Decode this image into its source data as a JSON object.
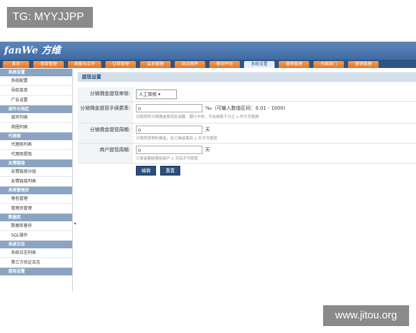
{
  "watermarks": {
    "top_left": "TG: MYYJJPP",
    "bottom_right": "www.jitou.org"
  },
  "header": {
    "logo": "fanWe 方维"
  },
  "nav": [
    {
      "label": "首页",
      "active": false
    },
    {
      "label": "项目管理",
      "active": false
    },
    {
      "label": "商家与点评",
      "active": false
    },
    {
      "label": "订单管理",
      "active": false
    },
    {
      "label": "会员管理",
      "active": false
    },
    {
      "label": "站点邮件",
      "active": false
    },
    {
      "label": "移动平台",
      "active": false
    },
    {
      "label": "系统设置",
      "active": true
    },
    {
      "label": "营销管理",
      "active": false
    },
    {
      "label": "分类部门",
      "active": false
    },
    {
      "label": "营销管理",
      "active": false
    }
  ],
  "sidebar": [
    {
      "group": "系统设置",
      "items": [
        "系统配置",
        "导航菜单",
        "广告设置"
      ]
    },
    {
      "group": "城市与地区",
      "items": [
        "城市列表",
        "商圈列表"
      ]
    },
    {
      "group": "代理商",
      "items": [
        "代理商列表",
        "代理商提现"
      ]
    },
    {
      "group": "友情链接",
      "items": [
        "友情链接分组",
        "友情链接列表"
      ]
    },
    {
      "group": "系统管理员",
      "items": [
        "角色管理",
        "管理员管理"
      ]
    },
    {
      "group": "数据库",
      "items": [
        "数据库备份",
        "SQL操作"
      ]
    },
    {
      "group": "系统日志",
      "items": [
        "系统日志列表",
        "第三方验证日志"
      ]
    },
    {
      "group": "提现设置",
      "items": []
    }
  ],
  "sidebar_toggle": "◂",
  "panel": {
    "title": "提现设置"
  },
  "form": {
    "row1": {
      "label": "分销佣金提现审核:",
      "value": "人工审核",
      "arrow": "▾"
    },
    "row2": {
      "label": "分销佣金提现手续费率:",
      "value": "0",
      "unit": "‰（可输入数值区间：0.01 - 1000）",
      "hint": "分销员所分销佣金提现至余额、银行卡时，平台收取千分之 x 作为手续费"
    },
    "row3": {
      "label": "分销佣金提现周期:",
      "value": "0",
      "unit": "天",
      "hint": "分销员获得的佣金，在订单结束后 n 天才可提现"
    },
    "row4": {
      "label": "商户提现周期:",
      "value": "0",
      "unit": "天",
      "hint": "订单金额结算给商户 n 天后才可提现"
    }
  },
  "buttons": {
    "edit": "编辑",
    "reset": "重置"
  }
}
